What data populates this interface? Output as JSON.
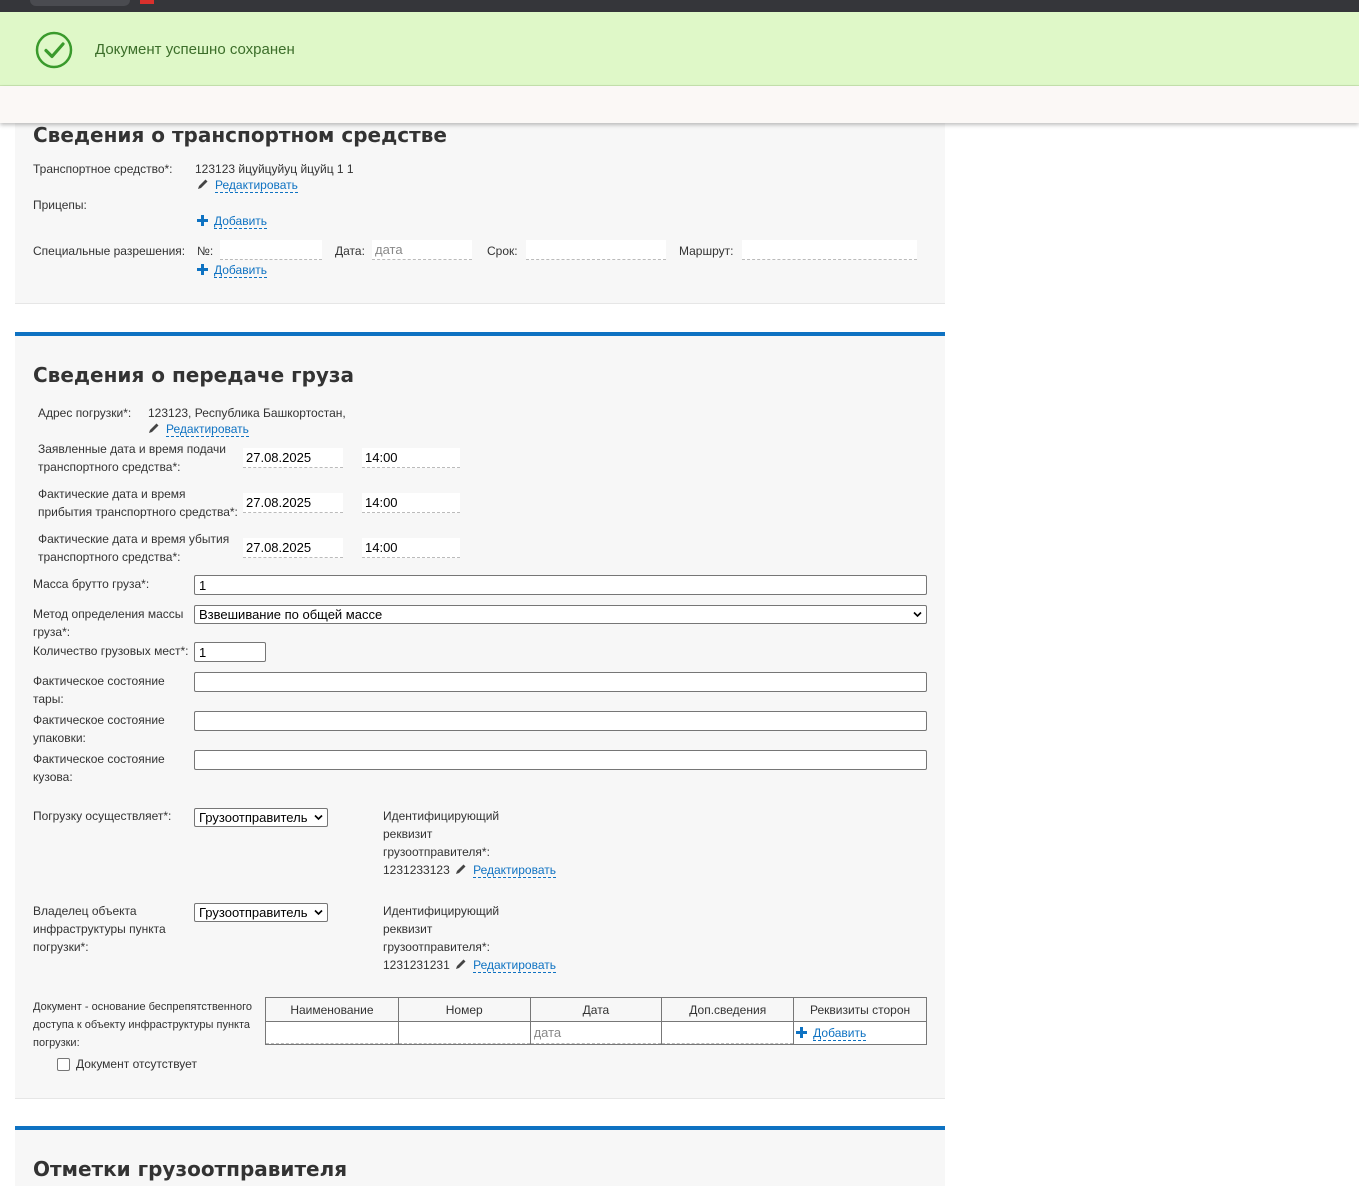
{
  "notice": {
    "message": "Документ успешно сохранен"
  },
  "vehicle_section": {
    "title": "Сведения о транспортном средстве",
    "vehicle_label": "Транспортное средство*:",
    "vehicle_value": "123123 йцуйцуйуц йцуйц 1 1",
    "edit_label": "Редактировать",
    "trailers_label": "Прицепы:",
    "add_label": "Добавить",
    "permits_label": "Специальные разрешения:",
    "permit_number_label": "№:",
    "permit_date_label": "Дата:",
    "permit_date_placeholder": "дата",
    "permit_term_label": "Срок:",
    "permit_route_label": "Маршрут:"
  },
  "cargo_section": {
    "title": "Сведения о передаче груза",
    "address_label": "Адрес погрузки*:",
    "address_value": "123123, Республика Башкортостан,",
    "edit_label": "Редактировать",
    "declared_label_1": "Заявленные дата и время подачи",
    "declared_label_2": "транспортного средства*:",
    "declared_date": "27.08.2025",
    "declared_time": "14:00",
    "arrival_label_1": "Фактические дата и время",
    "arrival_label_2": "прибытия транспортного средства*:",
    "arrival_date": "27.08.2025",
    "arrival_time": "14:00",
    "departure_label_1": "Фактические дата и время убытия",
    "departure_label_2": "транспортного средства*:",
    "departure_date": "27.08.2025",
    "departure_time": "14:00",
    "gross_mass_label": "Масса брутто груза*:",
    "gross_mass_value": "1",
    "mass_method_label_1": "Метод определения массы",
    "mass_method_label_2": "груза*:",
    "mass_method_value": "Взвешивание по общей массе",
    "places_label": "Количество грузовых мест*:",
    "places_value": "1",
    "tara_label_1": "Фактическое состояние",
    "tara_label_2": "тары:",
    "pack_label_1": "Фактическое состояние",
    "pack_label_2": "упаковки:",
    "body_label_1": "Фактическое состояние",
    "body_label_2": "кузова:",
    "loader_label": "Погрузку осуществляет*:",
    "loader_value": "Грузоотправитель",
    "loader_id_label_1": "Идентифицирующий",
    "loader_id_label_2": "реквизит",
    "loader_id_label_3": "грузоотправителя*:",
    "loader_id_value": "1231233123",
    "owner_label_1": "Владелец объекта",
    "owner_label_2": "инфраструктуры пункта",
    "owner_label_3": "погрузки*:",
    "owner_value": "Грузоотправитель",
    "owner_id_label_1": "Идентифицирующий",
    "owner_id_label_2": "реквизит",
    "owner_id_label_3": "грузоотправителя*:",
    "owner_id_value": "1231231231",
    "doc_label_1": "Документ - основание беспрепятственного",
    "doc_label_2": "доступа к объекту инфраструктуры пункта",
    "doc_label_3": "погрузки:",
    "doc_columns": [
      "Наименование",
      "Номер",
      "Дата",
      "Доп.сведения",
      "Реквизиты сторон"
    ],
    "doc_date_placeholder": "дата",
    "add_label": "Добавить",
    "no_doc_label": "Документ отсутствует"
  },
  "shipper_section": {
    "title": "Отметки грузоотправителя"
  },
  "colors": {
    "accent": "#0e72c2",
    "success_bg": "#dff8c8",
    "success_icon": "#3a9a2c"
  }
}
